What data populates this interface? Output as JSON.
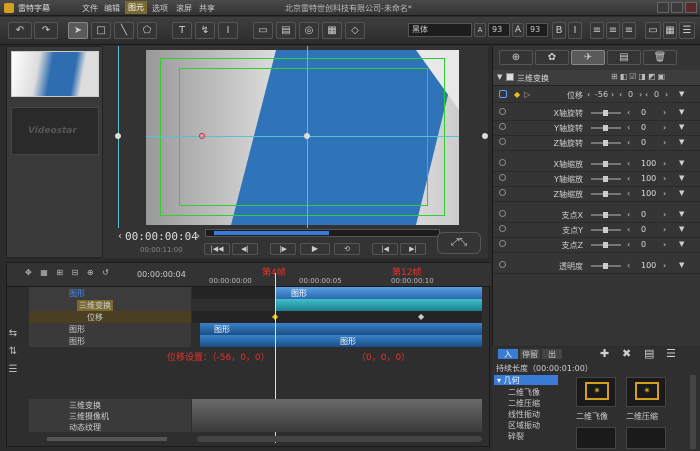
{
  "app": {
    "title": "雷特字幕",
    "document": "北京雷特世创科技有限公司-未命名*"
  },
  "menu": [
    "文件",
    "编辑",
    "图元",
    "选项",
    "滚屏",
    "共享"
  ],
  "toolbar": {
    "font": "黑体",
    "size1": "93",
    "size2": "93"
  },
  "thumbs": {
    "logo": "Videostar"
  },
  "preview": {
    "timecode": "00:00:00:04",
    "total": "00:00:11:00"
  },
  "timeline": {
    "timecode": "00:00:00:04",
    "ticks": [
      "00:00:00:00",
      "00:00:00:05",
      "00:00:00:10"
    ],
    "marker_left": "第4帧",
    "marker_right": "第12帧",
    "rows": [
      "图形",
      "三维变换",
      "位移",
      "图形",
      "图形"
    ],
    "clip_labels": [
      "图形",
      "图形",
      "图形"
    ],
    "bottom_rows": [
      "三维变换",
      "三维摄像机",
      "动态纹理"
    ],
    "note_left": "位移设置：（-56，0，0）",
    "note_right": "（0，0，0）"
  },
  "props": {
    "section": "三维变换",
    "position_label": "位移",
    "position_val": "-56",
    "position_y": "0",
    "position_z": "0",
    "items": [
      {
        "label": "X轴旋转",
        "val": "0"
      },
      {
        "label": "Y轴旋转",
        "val": "0"
      },
      {
        "label": "Z轴旋转",
        "val": "0"
      },
      {
        "label": "X轴缩放",
        "val": "100"
      },
      {
        "label": "Y轴缩放",
        "val": "100"
      },
      {
        "label": "Z轴缩放",
        "val": "100"
      },
      {
        "label": "支点X",
        "val": "0"
      },
      {
        "label": "支点Y",
        "val": "0"
      },
      {
        "label": "支点Z",
        "val": "0"
      },
      {
        "label": "透明度",
        "val": "100"
      }
    ]
  },
  "library": {
    "tabs": [
      "入",
      "停留",
      "出"
    ],
    "duration_label": "持续长度（00:00:01:00）",
    "category": "几何",
    "items": [
      "二维飞像",
      "二维压缩",
      "线性振动",
      "区域振动",
      "碎裂"
    ],
    "thumb_labels": [
      "二维飞像",
      "二维压缩"
    ]
  }
}
